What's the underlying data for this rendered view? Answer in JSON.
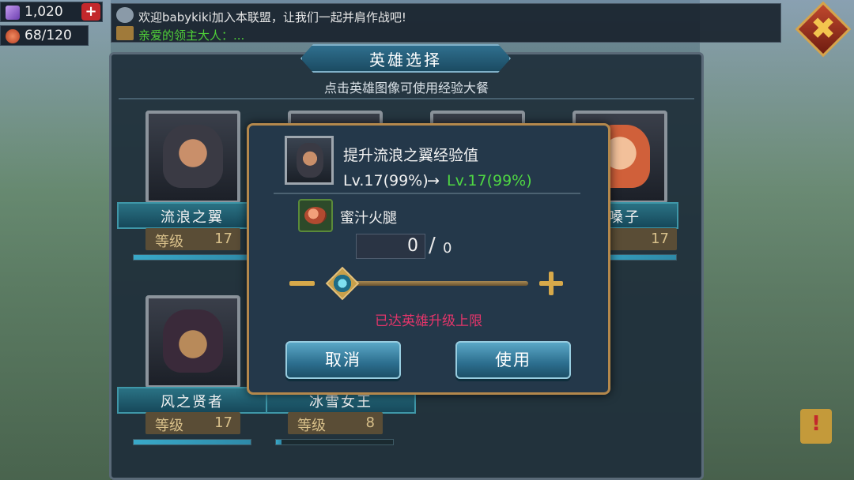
{
  "resources": {
    "gems": "1,020",
    "gems_plus": "+",
    "stamina": "68/120"
  },
  "chat": {
    "line1": "欢迎babykiki加入本联盟，让我们一起并肩作战吧!",
    "line2": "亲爱的领主大人：..."
  },
  "close_label": "✖",
  "panel": {
    "title": "英雄选择",
    "subtitle": "点击英雄图像可使用经验大餐",
    "heroes": [
      {
        "name": "流浪之翼",
        "level_label": "等级",
        "level": "17",
        "exp": 1.0
      },
      {
        "name": "嗓子",
        "level_label": "级",
        "level": "17",
        "exp": 1.0
      },
      {
        "name": "风之贤者",
        "level_label": "等级",
        "level": "17",
        "exp": 1.0
      },
      {
        "name": "冰雪女王",
        "level_label": "等级",
        "level": "8",
        "exp": 0.05
      }
    ]
  },
  "modal": {
    "title": "提升流浪之翼经验值",
    "level_from": "Lv.17(99%)",
    "arrow": "→",
    "level_to": "Lv.17(99%)",
    "item_name": "蜜汁火腿",
    "quantity": "0",
    "slash": "/",
    "quantity_max": "0",
    "warning": "已达英雄升级上限",
    "cancel_label": "取消",
    "use_label": "使用",
    "slider_value": 0
  },
  "alert_icon": "!",
  "colors": {
    "accent_green": "#4fd843",
    "warning_pink": "#e2356a",
    "button_blue": "#2c6e8e",
    "gold_border": "#b4884c"
  }
}
